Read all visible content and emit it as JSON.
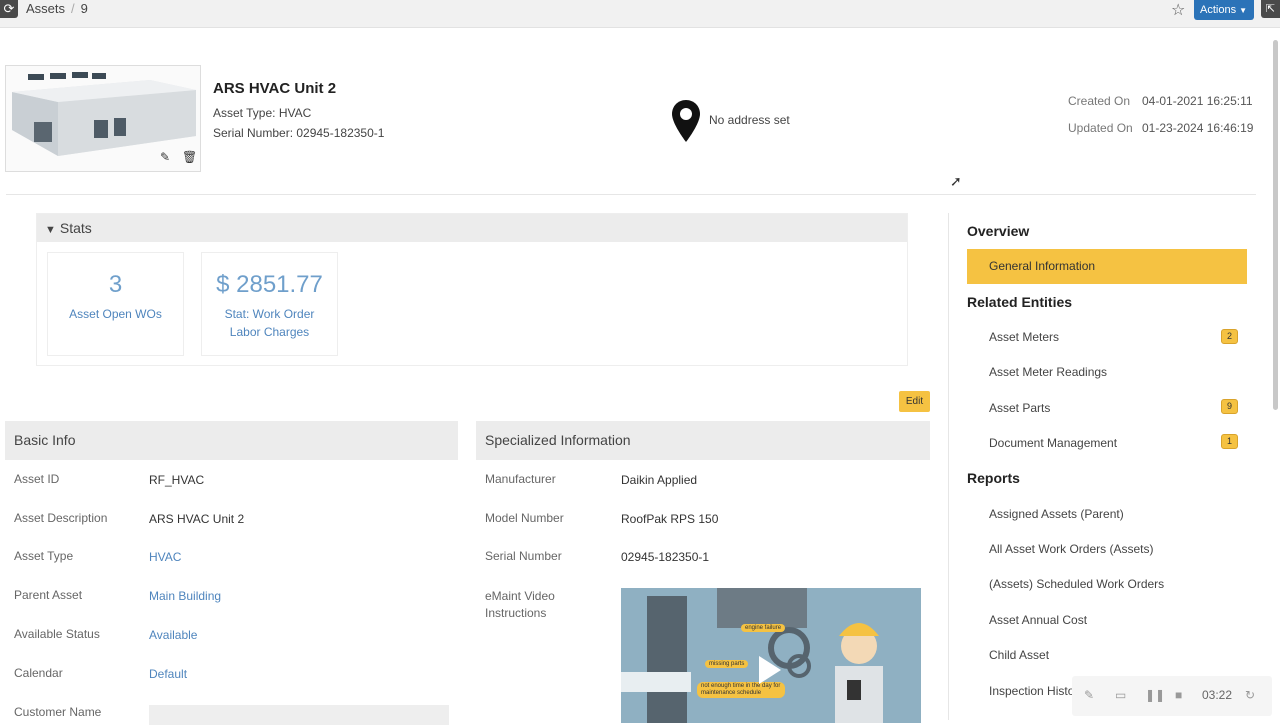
{
  "topbar": {
    "breadcrumb_root": "Assets",
    "breadcrumb_sep": "/",
    "breadcrumb_id": "9",
    "actions_label": "Actions"
  },
  "asset": {
    "name": "ARS HVAC Unit 2",
    "type_line": "Asset Type: HVAC",
    "serial_line": "Serial Number:  02945-182350-1",
    "address": "No address set",
    "created_label": "Created On",
    "created_value": "04-01-2021 16:25:11",
    "updated_label": "Updated On",
    "updated_value": "01-23-2024 16:46:19"
  },
  "stats": {
    "title": "Stats",
    "items": [
      {
        "value": "3",
        "label": "Asset Open WOs"
      },
      {
        "value": "$ 2851.77",
        "label": "Stat: Work Order Labor Charges"
      }
    ]
  },
  "edit_label": "Edit",
  "basic_info": {
    "title": "Basic Info",
    "fields": [
      {
        "label": "Asset ID",
        "value": "RF_HVAC"
      },
      {
        "label": "Asset Description",
        "value": "ARS HVAC Unit 2"
      },
      {
        "label": "Asset Type",
        "value": "HVAC"
      },
      {
        "label": "Parent Asset",
        "value": "Main Building"
      },
      {
        "label": "Available Status",
        "value": "Available"
      },
      {
        "label": "Calendar",
        "value": "Default"
      },
      {
        "label": "Customer Name",
        "value": ""
      }
    ]
  },
  "specialized": {
    "title": "Specialized Information",
    "fields": [
      {
        "label": "Manufacturer",
        "value": "Daikin Applied"
      },
      {
        "label": "Model Number",
        "value": "RoofPak RPS 150"
      },
      {
        "label": "Serial Number",
        "value": "02945-182350-1"
      },
      {
        "label": "eMaint Video Instructions",
        "value": ""
      }
    ],
    "video_tags": [
      "engine failure",
      "missing parts",
      "not enough time in the day for maintenance schedule"
    ]
  },
  "nav": {
    "overview_title": "Overview",
    "general_info": "General Information",
    "related_title": "Related Entities",
    "related": [
      {
        "label": "Asset Meters",
        "badge": "2"
      },
      {
        "label": "Asset Meter Readings",
        "badge": ""
      },
      {
        "label": "Asset Parts",
        "badge": "9"
      },
      {
        "label": "Document Management",
        "badge": "1"
      }
    ],
    "reports_title": "Reports",
    "reports": [
      "Assigned Assets (Parent)",
      "All Asset Work Orders (Assets)",
      "(Assets) Scheduled Work Orders",
      "Asset Annual Cost",
      "Child Asset",
      "Inspection History"
    ]
  },
  "player": {
    "time": "03:22"
  },
  "colors": {
    "accent": "#f5c242",
    "link": "#4f85bd",
    "primary": "#2b73b8"
  }
}
